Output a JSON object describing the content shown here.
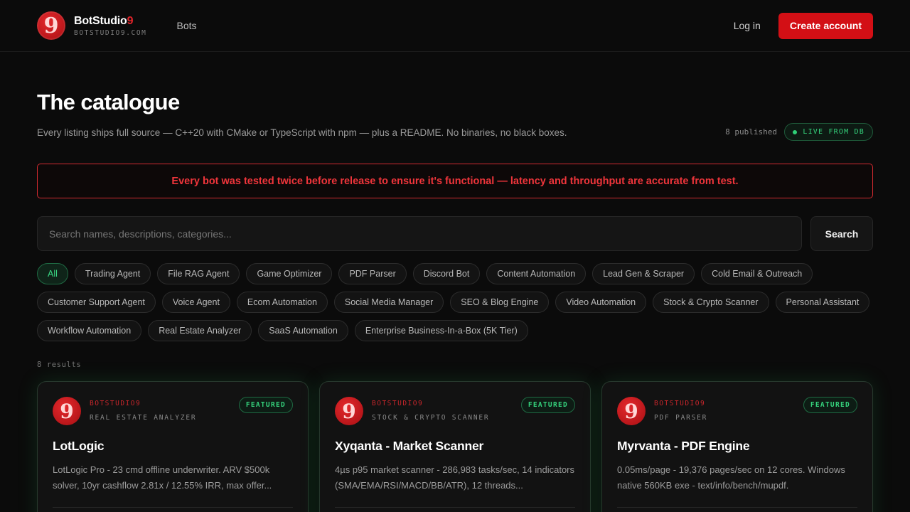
{
  "header": {
    "logo_glyph": "9",
    "brand_name": "BotStudio",
    "brand_accent": "9",
    "brand_domain": "BOTSTUDIO9.COM",
    "nav": {
      "bots": "Bots"
    },
    "login": "Log in",
    "create_account": "Create account"
  },
  "catalogue": {
    "title": "The catalogue",
    "subtitle": "Every listing ships full source — C++20 with CMake or TypeScript with npm — plus a README. No binaries, no black boxes.",
    "published": "8 published",
    "live_badge": "LIVE FROM DB"
  },
  "alert": "Every bot was tested twice before release to ensure it's functional — latency and throughput are accurate from test.",
  "search": {
    "placeholder": "Search names, descriptions, categories...",
    "value": "",
    "button": "Search"
  },
  "filters": [
    {
      "label": "All",
      "active": true
    },
    {
      "label": "Trading Agent"
    },
    {
      "label": "File RAG Agent"
    },
    {
      "label": "Game Optimizer"
    },
    {
      "label": "PDF Parser"
    },
    {
      "label": "Discord Bot"
    },
    {
      "label": "Content Automation"
    },
    {
      "label": "Lead Gen & Scraper"
    },
    {
      "label": "Cold Email & Outreach"
    },
    {
      "label": "Customer Support Agent"
    },
    {
      "label": "Voice Agent"
    },
    {
      "label": "Ecom Automation"
    },
    {
      "label": "Social Media Manager"
    },
    {
      "label": "SEO & Blog Engine"
    },
    {
      "label": "Video Automation"
    },
    {
      "label": "Stock & Crypto Scanner"
    },
    {
      "label": "Personal Assistant"
    },
    {
      "label": "Workflow Automation"
    },
    {
      "label": "Real Estate Analyzer"
    },
    {
      "label": "SaaS Automation"
    },
    {
      "label": "Enterprise Business-In-a-Box (5K Tier)"
    }
  ],
  "results_count": "8 results",
  "cards": [
    {
      "vendor": "BOTSTUDIO9",
      "category": "REAL ESTATE ANALYZER",
      "badge": "FEATURED",
      "title": "LotLogic",
      "description": "LotLogic Pro - 23 cmd offline underwriter. ARV $500k solver, 10yr cashflow 2.81x / 12.55% IRR, max offer..."
    },
    {
      "vendor": "BOTSTUDIO9",
      "category": "STOCK & CRYPTO SCANNER",
      "badge": "FEATURED",
      "title": "Xyqanta - Market Scanner",
      "description": "4µs p95 market scanner - 286,983 tasks/sec, 14 indicators (SMA/EMA/RSI/MACD/BB/ATR), 12 threads..."
    },
    {
      "vendor": "BOTSTUDIO9",
      "category": "PDF PARSER",
      "badge": "FEATURED",
      "title": "Myrvanta - PDF Engine",
      "description": "0.05ms/page - 19,376 pages/sec on 12 cores. Windows native 560KB exe - text/info/bench/mupdf."
    }
  ]
}
